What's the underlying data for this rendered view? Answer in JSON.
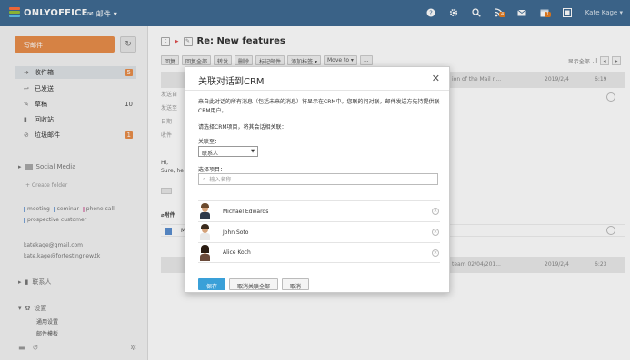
{
  "header": {
    "logo_text": "ONLYOFFICE",
    "module": "邮件",
    "user": "Kate Kage",
    "icons": [
      "help-icon",
      "settings-icon",
      "search-icon",
      "feed-icon",
      "mail-icon",
      "calendar-icon",
      "chat-icon"
    ],
    "badge_feed": "4",
    "badge_calendar": "1"
  },
  "sidebar": {
    "compose_label": "写邮件",
    "folders": [
      {
        "label": "收件箱",
        "count": "5",
        "icon": "inbox-icon"
      },
      {
        "label": "已发送",
        "count": "",
        "icon": "sent-icon"
      },
      {
        "label": "草稿",
        "count": "10",
        "icon": "drafts-icon"
      },
      {
        "label": "回收站",
        "count": "",
        "icon": "trash-icon"
      },
      {
        "label": "垃圾邮件",
        "count": "1",
        "icon": "spam-icon"
      }
    ],
    "social_media": "Social Media",
    "create_folder": "+ Create folder",
    "tags": [
      "meeting",
      "seminar",
      "phone call",
      "prospective customer"
    ],
    "tag_colors": [
      "#7aa3d6",
      "#7aa3d6",
      "#e0a0c0",
      "#7aa3d6"
    ],
    "accounts": [
      "katekage@gmail.com",
      "kate.kage@fortestingnew.tk"
    ],
    "contacts": "联系人",
    "settings": "设置",
    "settings_items": [
      "通用设置",
      "邮件模板"
    ]
  },
  "message": {
    "title": "Re: New features",
    "toolbar": [
      "回复",
      "回复全部",
      "转发",
      "删除",
      "标记邮件",
      "添加标签 ▾",
      "Move to ▾",
      "..."
    ],
    "pager_label": "显示全部",
    "row1_snippet": "ion of the Mail n...",
    "row1_date": "2019/2/4",
    "row1_time": "6:19",
    "detail_labels": [
      "发送自",
      "发送至",
      "日期",
      "收件"
    ],
    "body_lines": [
      "Hi,",
      "Sure, he"
    ],
    "attachments_label": "附件",
    "bottom_snippet": "team 02/04/201...",
    "bottom_date": "2019/2/4",
    "bottom_time": "6:23"
  },
  "modal": {
    "title": "关联对话到CRM",
    "description": "来自此对话的所有消息（包括未来的消息）将显示在CRM中。您联的问对联，邮件发送方先持提供联CRM用户。",
    "instruction": "请选择CRM项目，将其会话相关联：",
    "link_to_label": "关联至：",
    "link_to_value": "联系人",
    "select_project_label": "选择项目：",
    "search_placeholder": "输入名称",
    "contacts": [
      {
        "name": "Michael Edwards",
        "hair": "#6b4a2e",
        "shirt": "#2f3a4a"
      },
      {
        "name": "John Soto",
        "hair": "#3a2a1c",
        "shirt": "#ffffff"
      },
      {
        "name": "Alice Koch",
        "hair": "#2a1c12",
        "shirt": "#6a4a3a"
      }
    ],
    "save_label": "保存",
    "unlink_all_label": "取消关联全部",
    "cancel_label": "取消"
  }
}
